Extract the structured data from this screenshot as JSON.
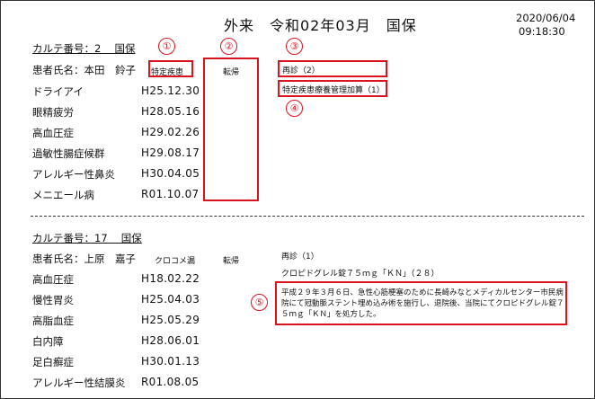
{
  "header": {
    "title": "外来　令和02年03月　国保",
    "date": "2020/06/04",
    "time": "09:18:30"
  },
  "patient1": {
    "card": "カルテ番号：2　 国保",
    "name": "患者氏名：本田　鈴子",
    "tag_disease": "特定疾患",
    "outcome": "転帰",
    "revisit": "再診（2）",
    "mgmt_fee": "特定疾患療養管理加算（1）",
    "diseases": [
      {
        "name": "ドライアイ",
        "date": "H25.12.30"
      },
      {
        "name": "眼精疲労",
        "date": "H28.05.16"
      },
      {
        "name": "高血圧症",
        "date": "H29.02.26"
      },
      {
        "name": "過敏性腸症候群",
        "date": "H29.08.17"
      },
      {
        "name": "アレルギー性鼻炎",
        "date": "H30.04.05"
      },
      {
        "name": "メニエール病",
        "date": "R01.10.07"
      }
    ]
  },
  "patient2": {
    "card": "カルテ番号：17　 国保",
    "name": "患者氏名：上原　嘉子",
    "tag_disease": "クロコメ漏",
    "outcome": "転帰",
    "revisit": "再診（1）",
    "prescription": "クロピドグレル錠７５ｍｇ「ＫＮ」（２８）",
    "note": "平成２９年３月６日、急性心筋梗塞のために長崎みなとメディカルセンター市民病院にて冠動脈ステント埋め込み術を施行し、退院後、当院にてクロピドグレル錠７５ｍｇ「ＫＮ」を処方した。",
    "diseases": [
      {
        "name": "高血圧症",
        "date": "H18.02.22"
      },
      {
        "name": "慢性胃炎",
        "date": "H25.04.03"
      },
      {
        "name": "高脂血症",
        "date": "H25.05.29"
      },
      {
        "name": "白内障",
        "date": "H28.06.01"
      },
      {
        "name": "足白癬症",
        "date": "H30.01.13"
      },
      {
        "name": "アレルギー性結膜炎",
        "date": "R01.08.05"
      }
    ]
  },
  "markers": [
    "①",
    "②",
    "③",
    "④",
    "⑤"
  ],
  "colors": {
    "highlight": "#d9141f",
    "text": "#111111"
  }
}
